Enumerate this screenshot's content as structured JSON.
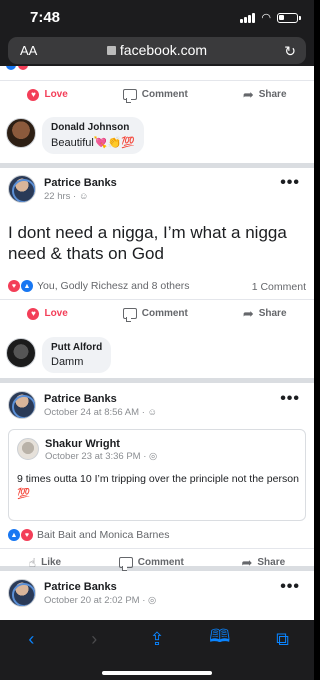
{
  "status": {
    "time": "7:48"
  },
  "browser": {
    "text_size": "AA",
    "domain": "facebook.com"
  },
  "posts": [
    {
      "actions": {
        "react": "Love",
        "comment": "Comment",
        "share": "Share"
      },
      "top_comment": {
        "name": "Donald Johnson",
        "text": "Beautiful💘👏💯"
      }
    },
    {
      "author": "Patrice Banks",
      "time": "22 hrs · ",
      "text": "I dont need a nigga, I’m what a nigga need & thats on God",
      "reactions": "You, Godly Richesz and 8 others",
      "comment_count": "1 Comment",
      "actions": {
        "react": "Love",
        "comment": "Comment",
        "share": "Share"
      },
      "top_comment": {
        "name": "Putt Alford",
        "text": "Damm"
      }
    },
    {
      "author": "Patrice Banks",
      "time": "October 24 at 8:56 AM · ",
      "shared": {
        "author": "Shakur Wright",
        "time": "October 23 at 3:36 PM · ",
        "text": "9 times outta 10 I’m tripping over the principle not the person 💯"
      },
      "reactions": "Bait Bait and Monica Barnes",
      "actions": {
        "react": "Like",
        "comment": "Comment",
        "share": "Share"
      }
    },
    {
      "author": "Patrice Banks",
      "time": "October 20 at 2:02 PM · "
    }
  ],
  "colors": {
    "fb_blue": "#1877f2",
    "love_red": "#f33e58",
    "ios_blue": "#0a84ff"
  }
}
